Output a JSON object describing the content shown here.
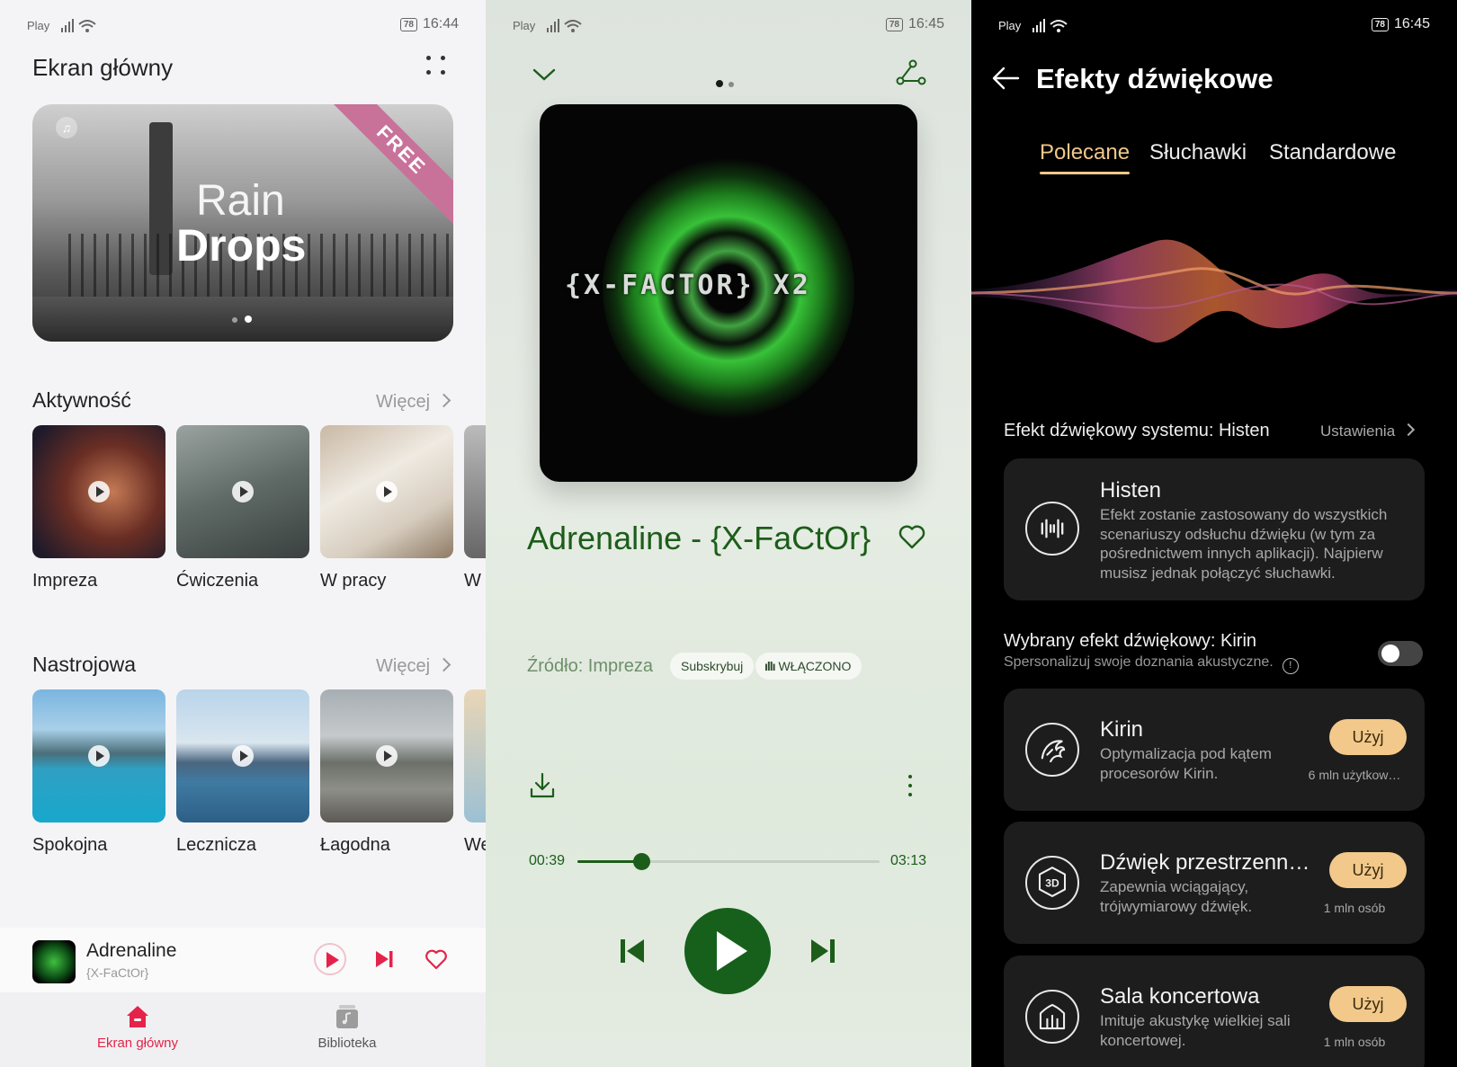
{
  "status_left": {
    "carrier": "Play",
    "battery": "78",
    "time": "16:44"
  },
  "status_mid": {
    "carrier": "Play",
    "battery": "78",
    "time": "16:45"
  },
  "status_right": {
    "carrier": "Play",
    "battery": "78",
    "time": "16:45"
  },
  "home": {
    "title": "Ekran główny",
    "banner": {
      "line1": "Rain",
      "line2": "Drops",
      "ribbon": "FREE",
      "slide": 2,
      "slides": 2
    },
    "sections": [
      {
        "title": "Aktywność",
        "more": "Więcej",
        "items": [
          {
            "label": "Impreza"
          },
          {
            "label": "Ćwiczenia"
          },
          {
            "label": "W pracy"
          },
          {
            "label": "W"
          }
        ]
      },
      {
        "title": "Nastrojowa",
        "more": "Więcej",
        "items": [
          {
            "label": "Spokojna"
          },
          {
            "label": "Lecznicza"
          },
          {
            "label": "Łagodna"
          },
          {
            "label": "We"
          }
        ]
      }
    ],
    "mini_player": {
      "title": "Adrenaline",
      "artist": "{X-FaCtOr}"
    },
    "tabs": [
      {
        "label": "Ekran główny",
        "active": true
      },
      {
        "label": "Biblioteka",
        "active": false
      }
    ],
    "accent": "#e5234a"
  },
  "player": {
    "album_text": "{X-FACTOR}  X2",
    "song": "Adrenaline - {X-FaCtOr}",
    "source": "Źródło: Impreza",
    "subscribe": "Subskrybuj",
    "enabled": "WŁĄCZONO",
    "elapsed": "00:39",
    "duration": "03:13",
    "progress": 0.21,
    "accent": "#1c5d1a"
  },
  "effects": {
    "title": "Efekty dźwiękowe",
    "tabs": [
      "Polecane",
      "Słuchawki",
      "Standardowe"
    ],
    "active_tab": 0,
    "system_label": "Efekt dźwiękowy systemu: Histen",
    "settings": "Ustawienia",
    "histen": {
      "name": "Histen",
      "desc": "Efekt zostanie zastosowany do wszystkich scenariuszy odsłuchu dźwięku (w tym za pośrednictwem innych aplikacji). Najpierw musisz jednak połączyć słuchawki."
    },
    "selected_label": "Wybrany efekt dźwiękowy: Kirin",
    "selected_sub": "Spersonalizuj swoje doznania akustyczne.",
    "toggle_on": false,
    "list": [
      {
        "name": "Kirin",
        "desc": "Optymalizacja pod kątem procesorów Kirin.",
        "button": "Użyj",
        "users": "6 mln użytkow…"
      },
      {
        "name": "Dźwięk przestrzenn…",
        "desc": "Zapewnia wciągający, trójwymiarowy dźwięk.",
        "button": "Użyj",
        "users": "1 mln osób"
      },
      {
        "name": "Sala koncertowa",
        "desc": "Imituje akustykę wielkiej sali koncertowej.",
        "button": "Użyj",
        "users": "1 mln osób"
      }
    ],
    "accent": "#f0c889"
  }
}
